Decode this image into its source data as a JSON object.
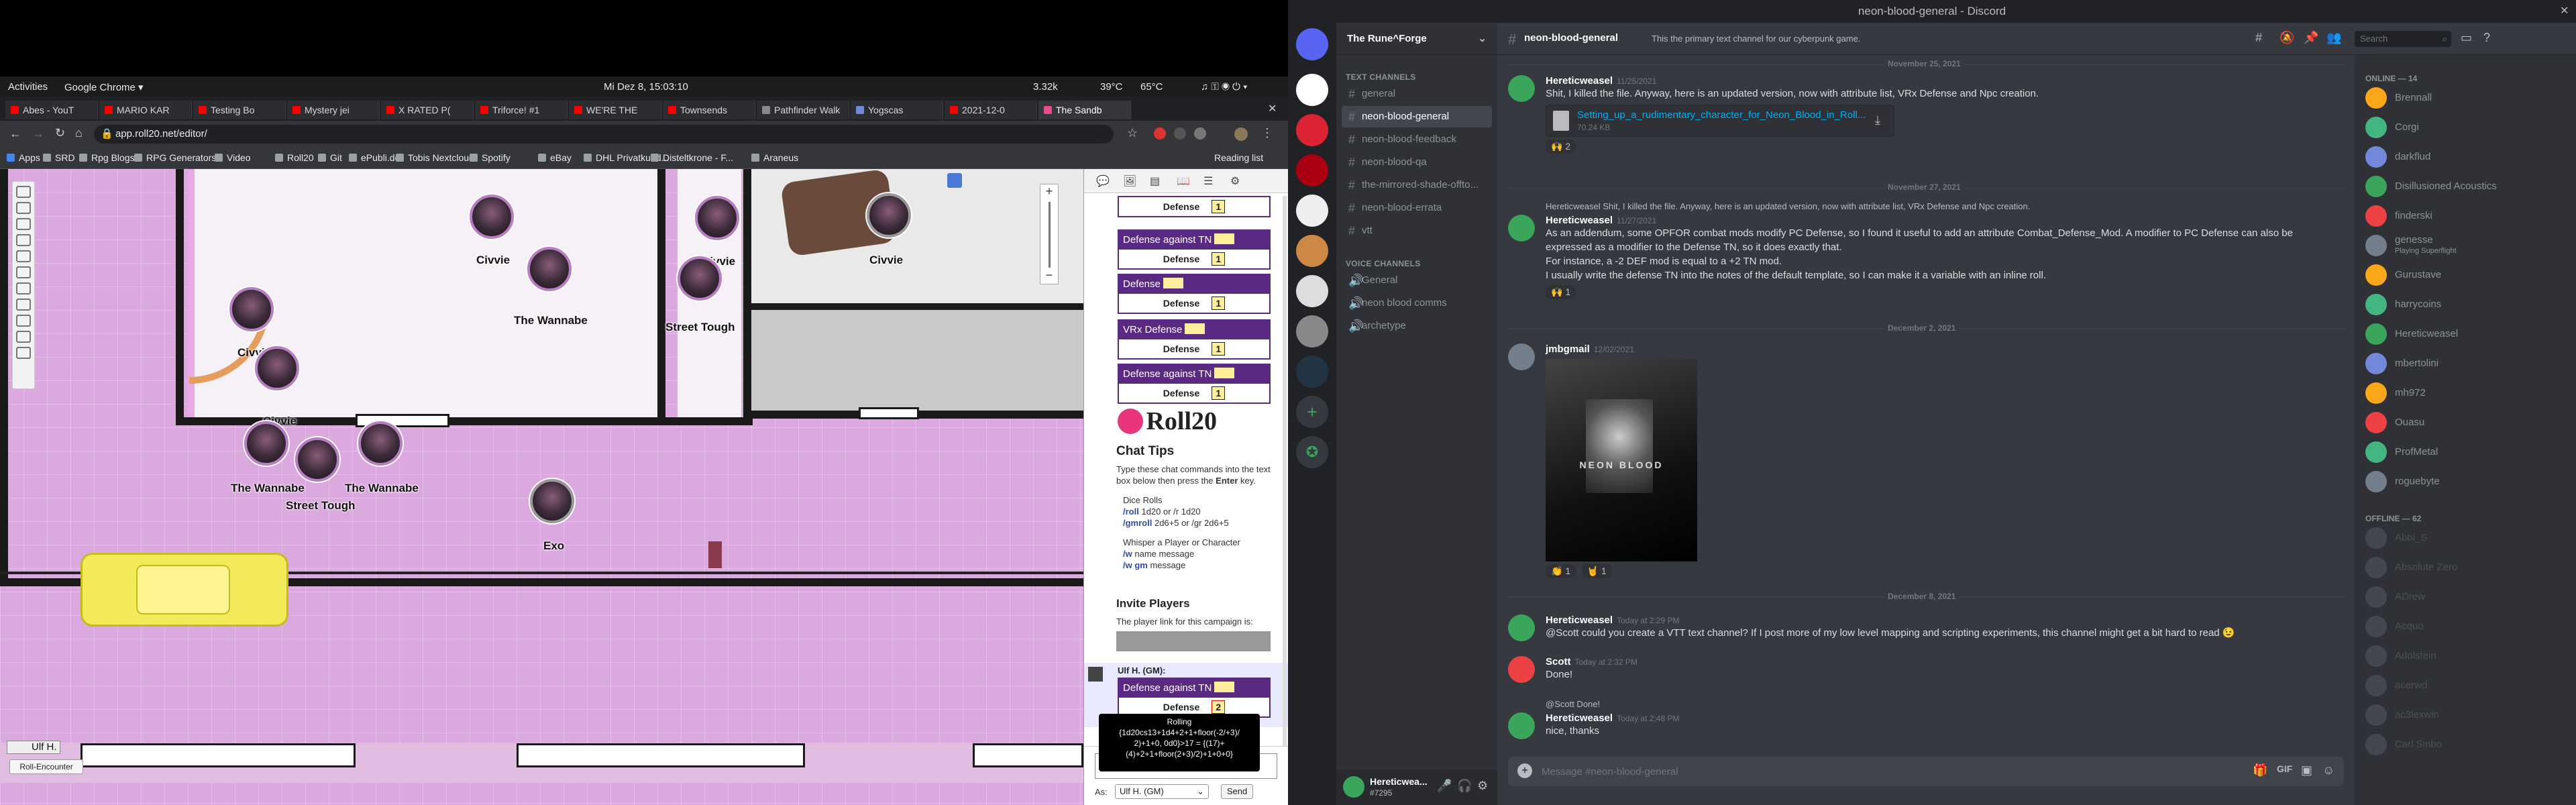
{
  "gnome": {
    "activities": "Activities",
    "app": "Google Chrome ▾",
    "clock": "Mi Dez 8, 15:03:10",
    "stats": [
      "3.32k",
      "39°C",
      "65°C"
    ]
  },
  "chrome": {
    "tabs": [
      {
        "label": "Abes - YouT",
        "color": "#f00"
      },
      {
        "label": "MARIO KAR",
        "color": "#f00"
      },
      {
        "label": "Testing Bo",
        "color": "#f00"
      },
      {
        "label": "Mystery jei",
        "color": "#f00"
      },
      {
        "label": "X RATED P(",
        "color": "#f00"
      },
      {
        "label": "Triforce! #1",
        "color": "#f00"
      },
      {
        "label": "WE'RE THE",
        "color": "#f00"
      },
      {
        "label": "Townsends",
        "color": "#f00"
      },
      {
        "label": "Pathfinder Walk",
        "color": "#888"
      },
      {
        "label": "Yogscas",
        "color": "#7289da"
      },
      {
        "label": "2021-12-0",
        "color": "#f00"
      },
      {
        "label": "The Sandb",
        "color": "#e94b8a"
      }
    ],
    "active_tab": 11,
    "url": "app.roll20.net/editor/",
    "bookmarks": [
      "Apps",
      "SRD",
      "Rpg Blogs",
      "RPG Generators",
      "Video",
      "Roll20",
      "Git",
      "ePubli.de",
      "Tobis Nextcloud",
      "Spotify",
      "eBay",
      "DHL Privatkund...",
      "Disteltkrone - F...",
      "Araneus"
    ],
    "reading_list": "Reading list"
  },
  "roll20": {
    "tokens": [
      {
        "label": "Civvie"
      },
      {
        "label": "Civvie"
      },
      {
        "label": "Civvie"
      },
      {
        "label": "The Wannabe"
      },
      {
        "label": "Civvie"
      },
      {
        "label": "Civvie"
      },
      {
        "label": "Street Tough"
      },
      {
        "label": "The Wannabe"
      },
      {
        "label": "Street Tough"
      },
      {
        "label": "The Wannabe"
      },
      {
        "label": "Exo"
      }
    ],
    "player_name": "Ulf H.",
    "encounter_button": "Roll-Encounter",
    "rolls": [
      {
        "head": "",
        "row": "Defense",
        "val": "1"
      },
      {
        "head": "Defense against TN",
        "row": "Defense",
        "val": "1"
      },
      {
        "head": "Defense",
        "row": "Defense",
        "val": "1"
      },
      {
        "head": "VRx Defense",
        "row": "Defense",
        "val": "1"
      },
      {
        "head": "Defense against TN",
        "row": "Defense",
        "val": "1"
      }
    ],
    "logo": "Roll20",
    "chat_tips": {
      "title": "Chat Tips",
      "intro": "Type these chat commands into the text box below then press the",
      "intro_key": "Enter",
      "intro_end": "key.",
      "dice_rolls": "Dice Rolls",
      "roll_cmd": "/roll",
      "roll_ex": "1d20 or /r 1d20",
      "gmroll_cmd": "/gmroll",
      "gmroll_ex": "2d6+5 or /gr 2d6+5",
      "whisper": "Whisper a Player or Character",
      "w_cmd": "/w",
      "w_ex": "name message",
      "wgm_cmd": "/w gm",
      "wgm_ex": "message"
    },
    "invite": {
      "title": "Invite Players",
      "text": "The player link for this campaign is:"
    },
    "gm_msg": {
      "author": "Ulf H. (GM):",
      "head": "Defense against TN",
      "row": "Defense",
      "val": "2"
    },
    "tooltip": {
      "title": "Rolling",
      "line1": "{1d20cs13+1d4+2+1+floor(-2/+3)/",
      "line2": "2)+1+0, 0d0}>17 = {(17)+",
      "line3": "(4)+2+1+floor(2+3)/2)+1+0+0}"
    },
    "as_label": "As:",
    "as_value": "Ulf H. (GM)",
    "send": "Send"
  },
  "discord": {
    "window_title": "neon-blood-general - Discord",
    "server": "The Rune^Forge",
    "text_category": "TEXT CHANNELS",
    "text_channels": [
      "general",
      "neon-blood-general",
      "neon-blood-feedback",
      "neon-blood-qa",
      "the-mirrored-shade-offto...",
      "neon-blood-errata",
      "vtt"
    ],
    "selected_channel": 1,
    "voice_category": "VOICE CHANNELS",
    "voice_channels": [
      "General",
      "neon blood comms",
      "archetype"
    ],
    "user": {
      "name": "Hereticwea...",
      "tag": "#7295"
    },
    "channel_title": "neon-blood-general",
    "channel_topic": "This the primary text channel for our cyberpunk game.",
    "search_placeholder": "Search",
    "date_seps": [
      "November 25, 2021",
      "November 27, 2021",
      "December 2, 2021",
      "December 8, 2021"
    ],
    "messages": [
      {
        "author": "Hereticweasel",
        "ts": "11/25/2021",
        "text": "Shit, I killed the file. Anyway, here is an updated version, now with attribute list, VRx Defense and Npc creation.",
        "color": "#3ba55c"
      },
      {
        "author": "Hereticweasel",
        "ts": "11/27/2021",
        "reply": "Hereticweasel Shit, I killed the file. Anyway, here is an updated version, now with attribute list, VRx Defense and Npc creation.",
        "text": "As an addendum, some OPFOR combat mods modify PC Defense, so I found it useful to add an attribute Combat_Defense_Mod. A modifier to PC Defense can also be expressed as a modifier to the Defense TN, so it does exactly that.",
        "text2": "For instance, a -2 DEF mod is equal to a +2 TN mod.",
        "text3": "I usually write the defense TN into the notes of the default template, so I can make it a variable with an inline roll.",
        "color": "#3ba55c"
      },
      {
        "author": "jmbgmail",
        "ts": "12/02/2021",
        "color": "#747f8d"
      },
      {
        "author": "Hereticweasel",
        "ts": "Today at 2:29 PM",
        "text": "@Scott could you create a VTT text channel? If I post more of my low level mapping and scripting experiments, this channel might get a bit hard to read 😉",
        "color": "#3ba55c"
      },
      {
        "author": "Scott",
        "ts": "Today at 2:32 PM",
        "text": "Done!",
        "color": "#ed4245"
      },
      {
        "author": "Hereticweasel",
        "ts": "Today at 2:48 PM",
        "reply": "@Scott Done!",
        "text": "nice, thanks",
        "color": "#3ba55c"
      }
    ],
    "attachment_name": "Setting_up_a_rudimentary_character_for_Neon_Blood_in_Roll...",
    "attachment_size": "70.24 KB",
    "image_caption": "NEON BLOOD",
    "reactions": [
      "🙌 2",
      "🙌 1",
      "👏 1",
      "🤘 1"
    ],
    "composer_placeholder": "Message #neon-blood-general",
    "online_header": "ONLINE — 14",
    "online": [
      "Brennall",
      "Corgi",
      "darkflud",
      "Disillusioned Acoustics",
      "finderski",
      "genesse",
      "Gurustave",
      "harrycoins",
      "Hereticweasel",
      "mbertolini",
      "mh972",
      "Ouasu",
      "ProfMetal",
      "roguebyte"
    ],
    "online_colors": [
      "#faa61a",
      "#43b581",
      "#7289da",
      "#3ba55c",
      "#ed4245",
      "#747f8d",
      "#faa61a",
      "#43b581",
      "#3ba55c",
      "#7289da",
      "#faa61a",
      "#ed4245",
      "#43b581",
      "#747f8d"
    ],
    "genesse_status": "Playing Superflight",
    "offline_header": "OFFLINE — 62",
    "offline": [
      "Abbi_S",
      "Absolute Zero",
      "ADrew",
      "Acquo",
      "Adolstein",
      "acerwd",
      "ac3lexwin",
      "Carl Sinbo"
    ]
  }
}
